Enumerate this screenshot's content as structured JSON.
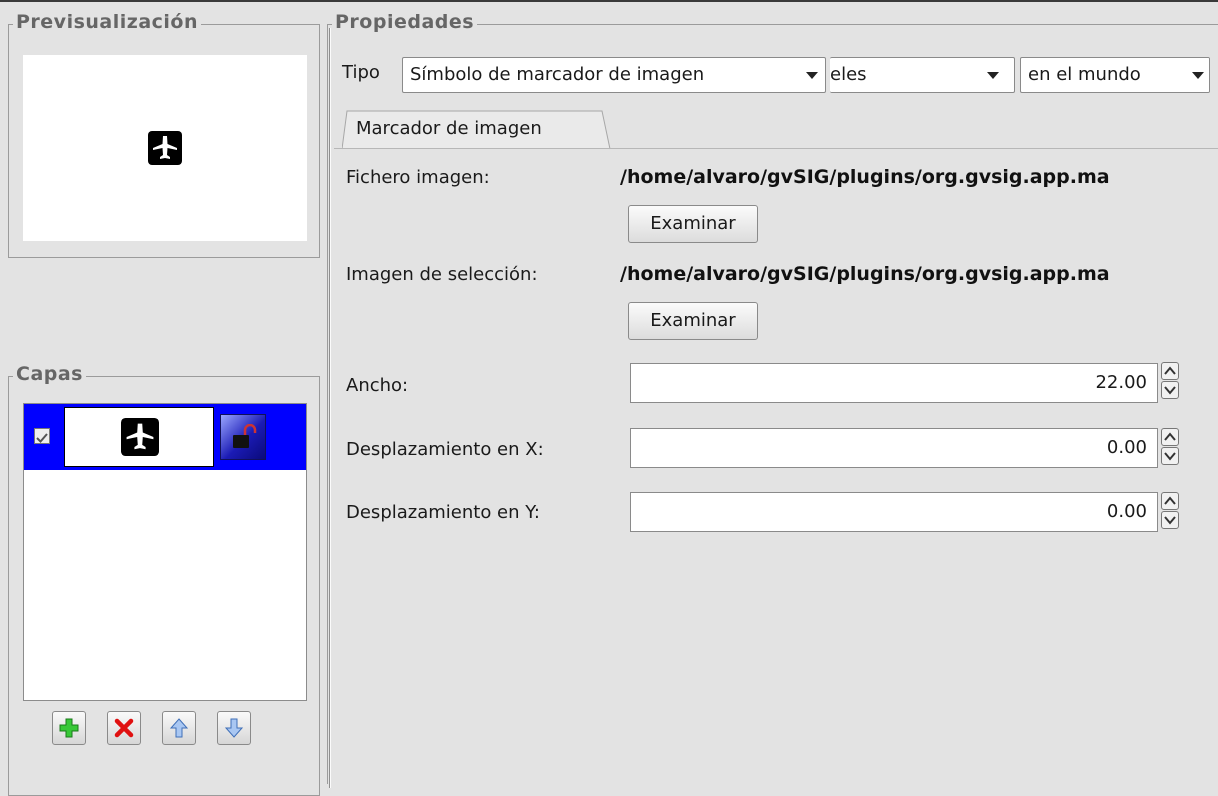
{
  "preview": {
    "title": "Previsualización",
    "icon": "airplane-icon"
  },
  "layers": {
    "title": "Capas",
    "items": [
      {
        "checked": true,
        "icon": "airplane-icon",
        "locked": false
      }
    ],
    "toolbar": [
      "add-icon",
      "delete-icon",
      "arrow-up-icon",
      "arrow-down-icon"
    ]
  },
  "properties": {
    "title": "Propiedades",
    "tipo_label": "Tipo",
    "tipo_value": "Símbolo de marcador de imagen",
    "units_value": "eles",
    "scope_value": "en el mundo",
    "tab_label": "Marcador de imagen",
    "fichero_label": "Fichero imagen:",
    "fichero_path": "/home/alvaro/gvSIG/plugins/org.gvsig.app.ma",
    "examinar_label": "Examinar",
    "seleccion_label": "Imagen de selección:",
    "seleccion_path": "/home/alvaro/gvSIG/plugins/org.gvsig.app.ma",
    "ancho_label": "Ancho:",
    "ancho_value": "22.00",
    "despx_label": "Desplazamiento en X:",
    "despx_value": "0.00",
    "despy_label": "Desplazamiento en Y:",
    "despy_value": "0.00"
  },
  "colors": {
    "selection": "#0000ff",
    "background": "#e3e3e3"
  }
}
